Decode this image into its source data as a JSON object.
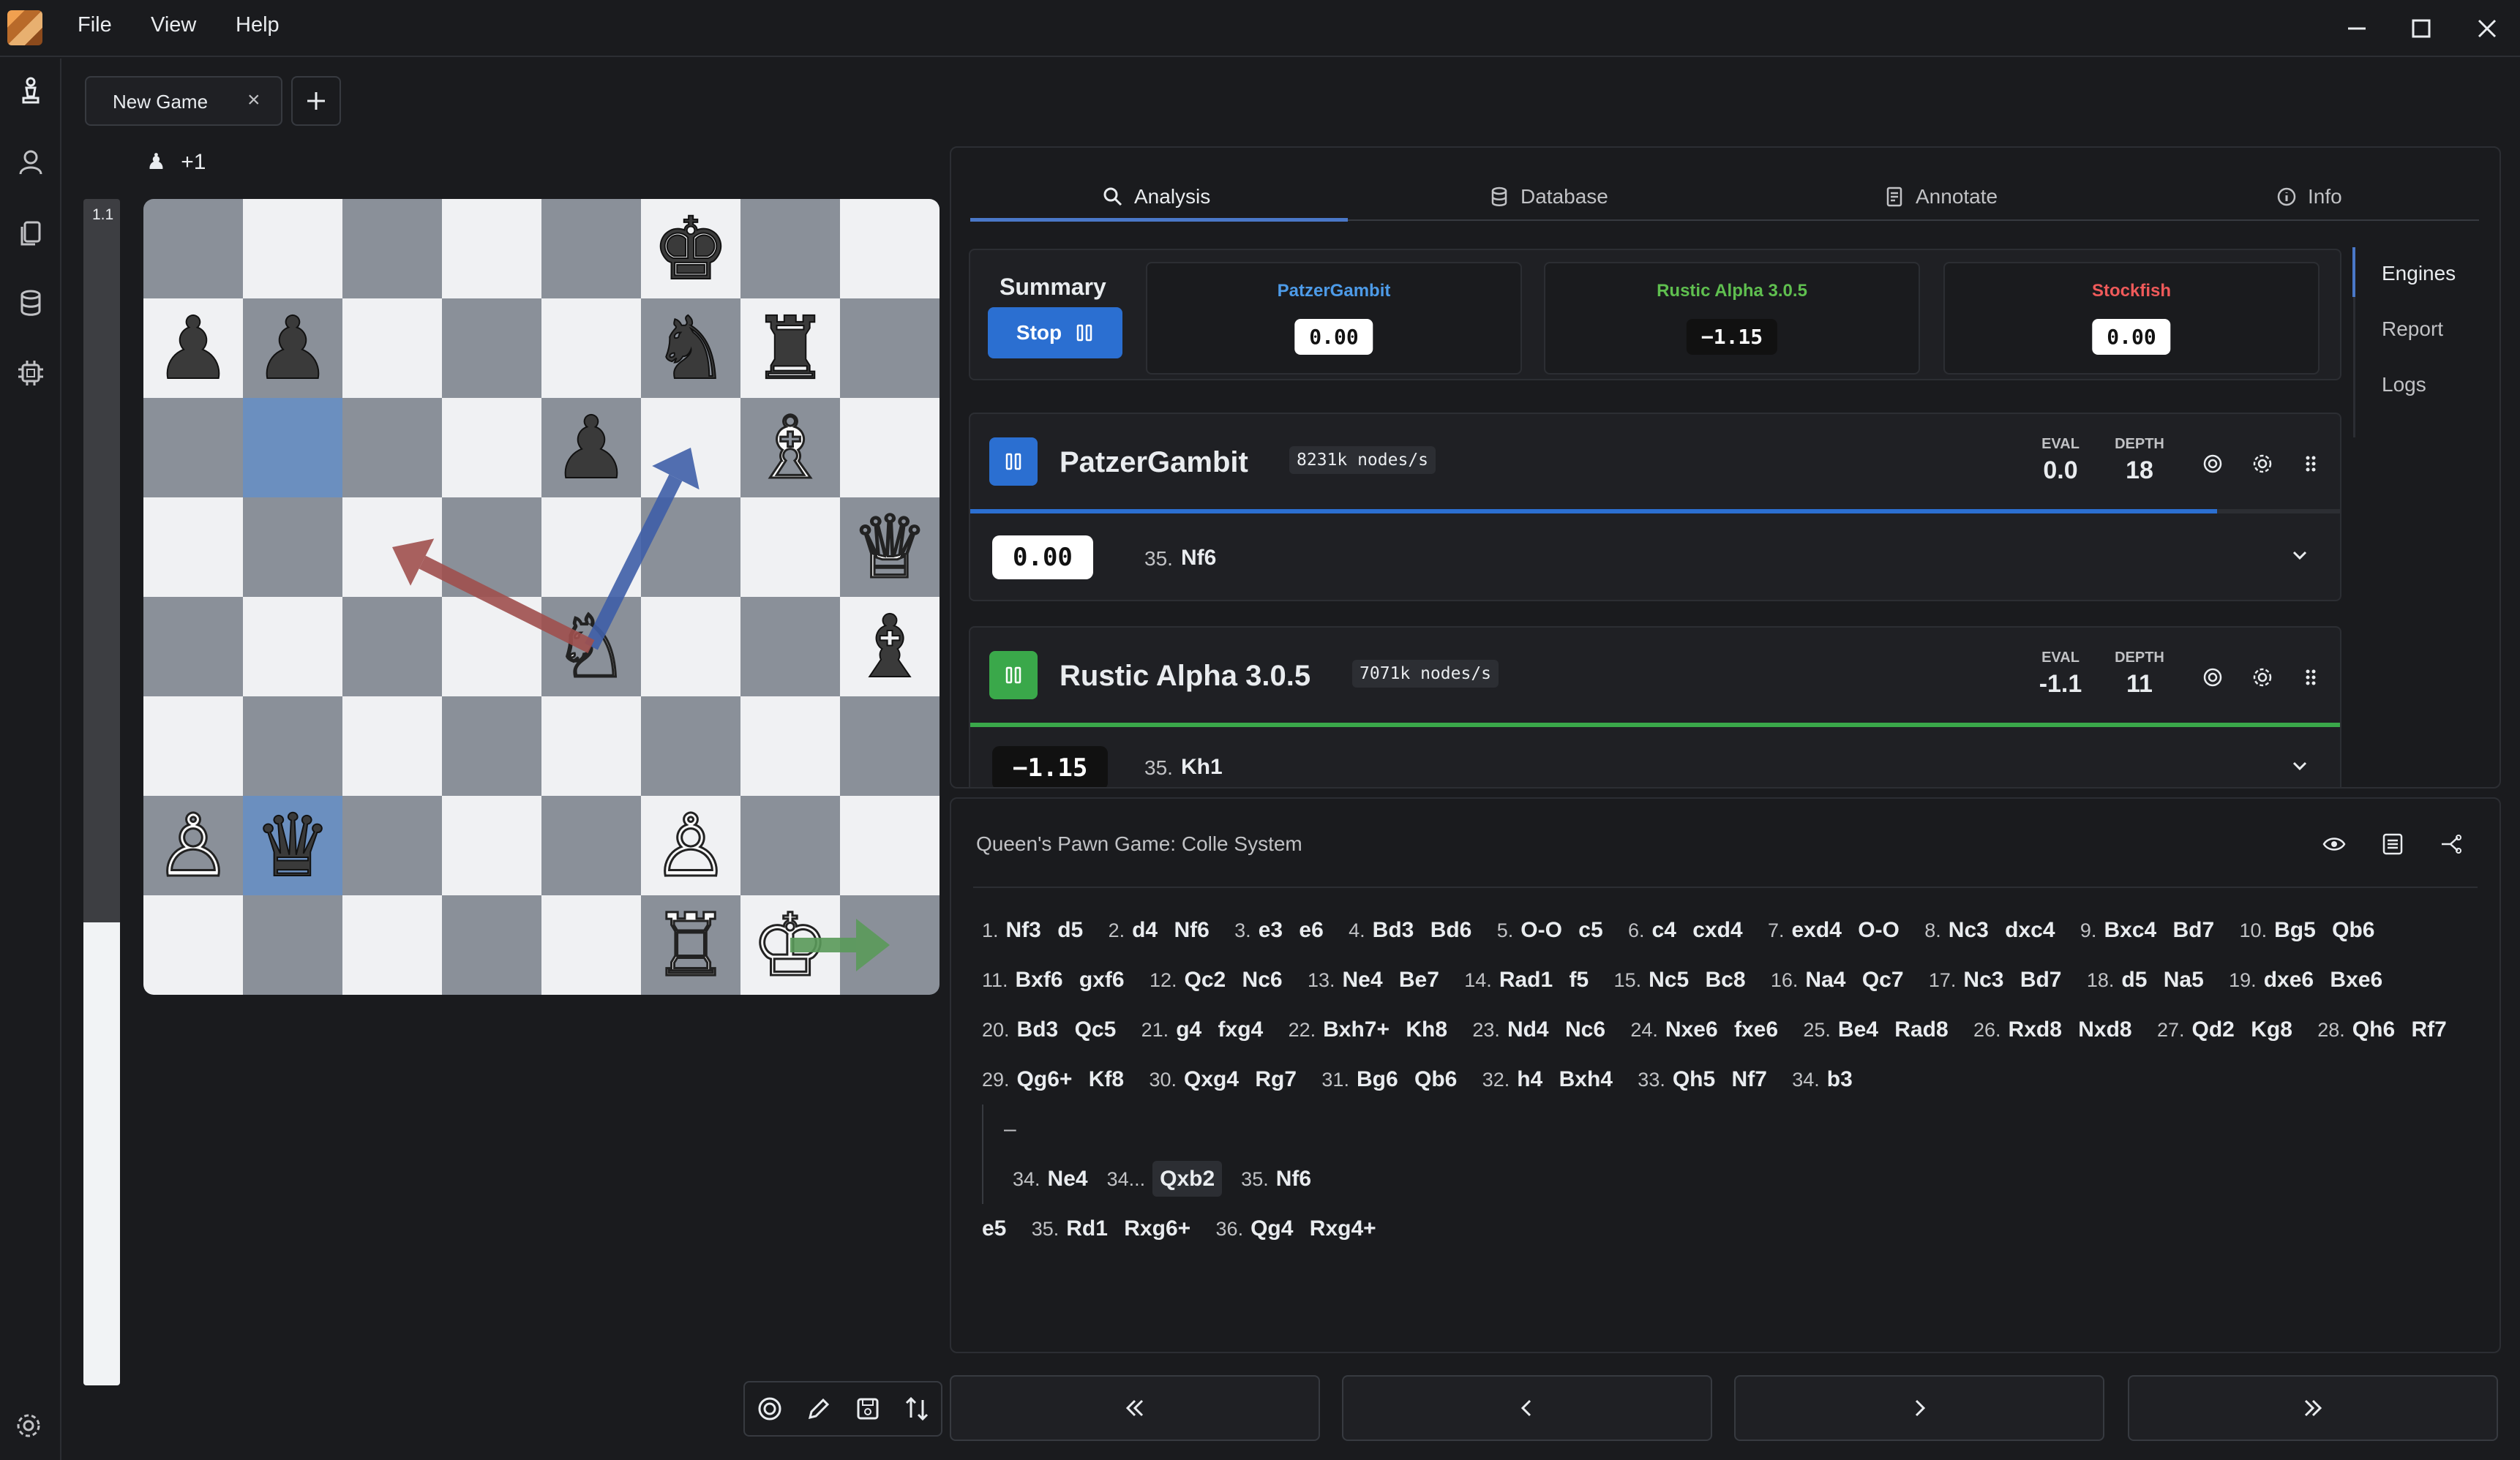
{
  "menu": {
    "file": "File",
    "view": "View",
    "help": "Help"
  },
  "tabs": {
    "game_tab": "New Game",
    "close": "×",
    "add": "+"
  },
  "material": {
    "advantage": "+1"
  },
  "evalbar": {
    "label": "1.1",
    "white_fraction": 0.39
  },
  "board": {
    "highlight": [
      "b6",
      "b2"
    ],
    "pieces": [
      {
        "sq": "f8",
        "g": "♚",
        "c": "b"
      },
      {
        "sq": "a7",
        "g": "♟",
        "c": "b"
      },
      {
        "sq": "b7",
        "g": "♟",
        "c": "b"
      },
      {
        "sq": "f7",
        "g": "♞",
        "c": "b"
      },
      {
        "sq": "g7",
        "g": "♜",
        "c": "b"
      },
      {
        "sq": "e6",
        "g": "♟",
        "c": "b"
      },
      {
        "sq": "g6",
        "g": "♗",
        "c": "w"
      },
      {
        "sq": "h5",
        "g": "♕",
        "c": "w"
      },
      {
        "sq": "e4",
        "g": "♘",
        "c": "w"
      },
      {
        "sq": "h4",
        "g": "♝",
        "c": "b"
      },
      {
        "sq": "a2",
        "g": "♙",
        "c": "w"
      },
      {
        "sq": "b2",
        "g": "♛",
        "c": "b"
      },
      {
        "sq": "f2",
        "g": "♙",
        "c": "w"
      },
      {
        "sq": "f1",
        "g": "♖",
        "c": "w"
      },
      {
        "sq": "g1",
        "g": "♔",
        "c": "w"
      }
    ],
    "arrows": [
      {
        "from": "e4",
        "to": "f6",
        "color": "#3f5fa8"
      },
      {
        "from": "e4",
        "to": "c5",
        "color": "#a0504e"
      },
      {
        "from": "g1",
        "to": "h1",
        "color": "#5a9a5a"
      }
    ]
  },
  "panel_tabs": {
    "analysis": "Analysis",
    "database": "Database",
    "annotate": "Annotate",
    "info": "Info"
  },
  "side_tabs": {
    "engines": "Engines",
    "report": "Report",
    "logs": "Logs"
  },
  "summary": {
    "title": "Summary",
    "stop": "Stop",
    "engines": [
      {
        "name": "PatzerGambit",
        "score": "0.00",
        "color": "#4d9be8",
        "style": "white"
      },
      {
        "name": "Rustic Alpha 3.0.5",
        "score": "−1.15",
        "color": "#5fbf4f",
        "style": "black"
      },
      {
        "name": "Stockfish",
        "score": "0.00",
        "color": "#ef5a5a",
        "style": "white"
      }
    ]
  },
  "engines": [
    {
      "name": "PatzerGambit",
      "nps": "8231k nodes/s",
      "eval_label": "EVAL",
      "eval": "0.0",
      "depth_label": "DEPTH",
      "depth": "18",
      "color": "#2b6fd1",
      "progress": 0.91,
      "line_score": "0.00",
      "line_style": "white",
      "move_num": "35.",
      "move": "Nf6"
    },
    {
      "name": "Rustic Alpha 3.0.5",
      "nps": "7071k nodes/s",
      "eval_label": "EVAL",
      "eval": "-1.1",
      "depth_label": "DEPTH",
      "depth": "11",
      "color": "#3aa84a",
      "progress": 1.0,
      "line_score": "−1.15",
      "line_style": "black",
      "move_num": "35.",
      "move": "Kh1"
    }
  ],
  "notation": {
    "opening": "Queen's Pawn Game: Colle System",
    "mainline": [
      [
        "1.",
        "Nf3",
        "d5"
      ],
      [
        "2.",
        "d4",
        "Nf6"
      ],
      [
        "3.",
        "e3",
        "e6"
      ],
      [
        "4.",
        "Bd3",
        "Bd6"
      ],
      [
        "5.",
        "O-O",
        "c5"
      ],
      [
        "6.",
        "c4",
        "cxd4"
      ],
      [
        "7.",
        "exd4",
        "O-O"
      ],
      [
        "8.",
        "Nc3",
        "dxc4"
      ],
      [
        "9.",
        "Bxc4",
        "Bd7"
      ],
      [
        "10.",
        "Bg5",
        "Qb6"
      ],
      [
        "11.",
        "Bxf6",
        "gxf6"
      ],
      [
        "12.",
        "Qc2",
        "Nc6"
      ],
      [
        "13.",
        "Ne4",
        "Be7"
      ],
      [
        "14.",
        "Rad1",
        "f5"
      ],
      [
        "15.",
        "Nc5",
        "Bc8"
      ],
      [
        "16.",
        "Na4",
        "Qc7"
      ],
      [
        "17.",
        "Nc3",
        "Bd7"
      ],
      [
        "18.",
        "d5",
        "Na5"
      ],
      [
        "19.",
        "dxe6",
        "Bxe6"
      ],
      [
        "20.",
        "Bd3",
        "Qc5"
      ],
      [
        "21.",
        "g4",
        "fxg4"
      ],
      [
        "22.",
        "Bxh7+",
        "Kh8"
      ],
      [
        "23.",
        "Nd4",
        "Nc6"
      ],
      [
        "24.",
        "Nxe6",
        "fxe6"
      ],
      [
        "25.",
        "Be4",
        "Rad8"
      ],
      [
        "26.",
        "Rxd8",
        "Nxd8"
      ],
      [
        "27.",
        "Qd2",
        "Kg8"
      ],
      [
        "28.",
        "Qh6",
        "Rf7"
      ],
      [
        "29.",
        "Qg6+",
        "Kf8"
      ],
      [
        "30.",
        "Qxg4",
        "Rg7"
      ],
      [
        "31.",
        "Bg6",
        "Qb6"
      ],
      [
        "32.",
        "h4",
        "Bxh4"
      ],
      [
        "33.",
        "Qh5",
        "Nf7"
      ],
      [
        "34.",
        "b3",
        ""
      ]
    ],
    "variation_dash": "–",
    "variation": {
      "n1": "34.",
      "m1": "Ne4",
      "n2": "34...",
      "m2": "Qxb2",
      "n3": "35.",
      "m3": "Nf6"
    },
    "tail": [
      [
        "",
        "e5"
      ],
      [
        "35.",
        "Rd1"
      ],
      [
        "",
        "Rxg6+"
      ],
      [
        "36.",
        "Qg4"
      ],
      [
        "",
        "Rxg4+"
      ]
    ]
  },
  "nav": {
    "first": "«",
    "prev": "‹",
    "next": "›",
    "last": "»"
  }
}
